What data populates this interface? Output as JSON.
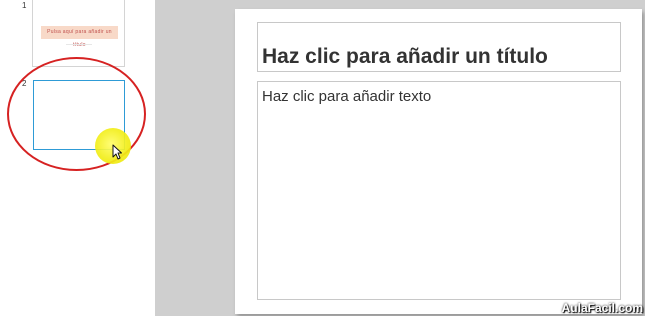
{
  "thumbnails": [
    {
      "number": "1",
      "title_text": "Pulsa aquí para añadir un título"
    },
    {
      "number": "2"
    }
  ],
  "slide": {
    "title_placeholder": "Haz clic para añadir un título",
    "body_placeholder": "Haz clic para añadir texto"
  },
  "watermark": "AulaFacil.com",
  "colors": {
    "selection_border": "#2e9bd6",
    "annotation_circle": "#d62222",
    "cursor_highlight": "#f2ee1a",
    "thumb_title_fill": "#f8d9c8",
    "thumb_title_text": "#c0504d"
  },
  "icons": {
    "cursor": "mouse-pointer-icon"
  }
}
